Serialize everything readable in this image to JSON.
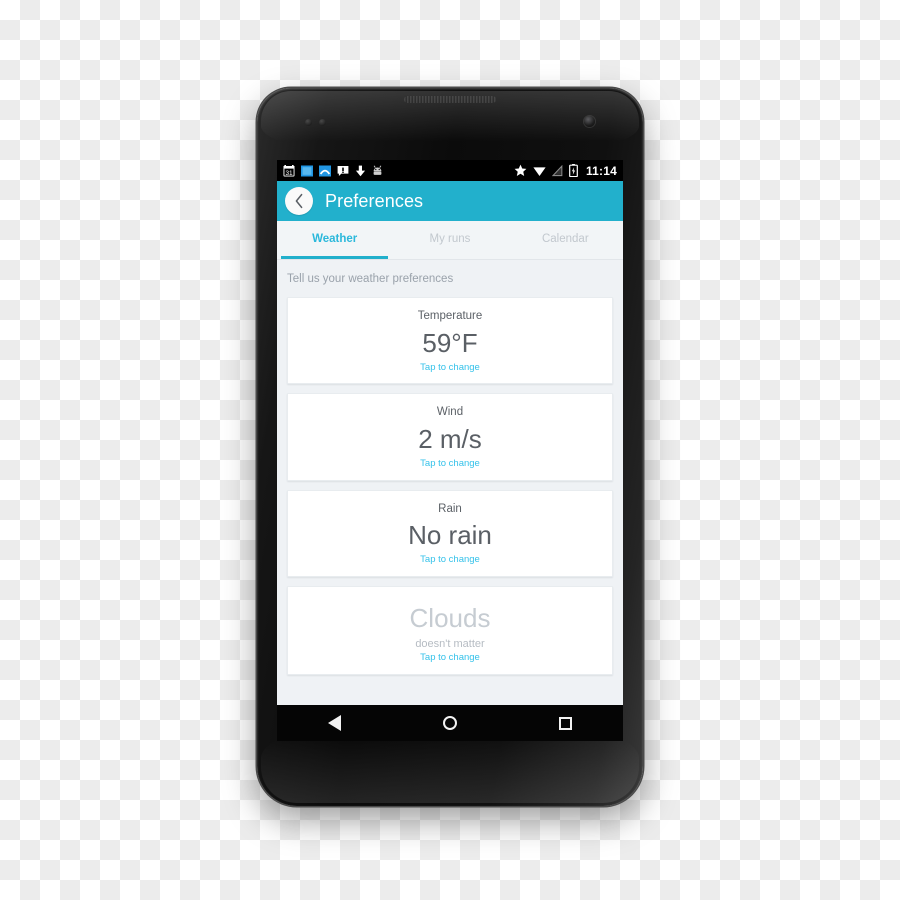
{
  "device": {
    "name": "android-phone-nexus",
    "frame_color": "#111111"
  },
  "status_bar": {
    "time": "11:14",
    "left_icons": [
      {
        "name": "calendar-icon",
        "label": "31"
      },
      {
        "name": "blue-square-icon",
        "label": ""
      },
      {
        "name": "weather-arc-icon",
        "label": ""
      },
      {
        "name": "alert-message-icon",
        "label": "!"
      },
      {
        "name": "download-icon",
        "label": ""
      },
      {
        "name": "android-robot-icon",
        "label": ""
      }
    ],
    "right_icons": [
      {
        "name": "star-icon",
        "label": ""
      },
      {
        "name": "wifi-icon",
        "label": ""
      },
      {
        "name": "signal-icon",
        "label": ""
      },
      {
        "name": "battery-charging-icon",
        "label": ""
      }
    ],
    "background": "#000000"
  },
  "action_bar": {
    "title": "Preferences",
    "back_icon": "chevron-left-icon",
    "background": "#22b0cc",
    "title_color": "#ffffff"
  },
  "tabs": {
    "active_index": 0,
    "items": [
      {
        "label": "Weather"
      },
      {
        "label": "My runs"
      },
      {
        "label": "Calendar"
      }
    ],
    "active_color": "#2bb8db",
    "inactive_color": "#c2c8ce"
  },
  "main": {
    "hint": "Tell us your weather preferences",
    "cards": [
      {
        "label": "Temperature",
        "value": "59°F",
        "sub": "",
        "action": "Tap to change",
        "muted": false
      },
      {
        "label": "Wind",
        "value": "2 m/s",
        "sub": "",
        "action": "Tap to change",
        "muted": false
      },
      {
        "label": "Rain",
        "value": "No rain",
        "sub": "",
        "action": "Tap to change",
        "muted": false
      },
      {
        "label": "",
        "value": "Clouds",
        "sub": "doesn't matter",
        "action": "Tap to change",
        "muted": true
      }
    ],
    "action_color": "#35c2ea",
    "card_background": "#ffffff",
    "page_background": "#eff2f5"
  },
  "nav_bar": {
    "buttons": [
      {
        "name": "nav-back-button",
        "icon": "triangle-left-icon"
      },
      {
        "name": "nav-home-button",
        "icon": "circle-icon"
      },
      {
        "name": "nav-recents-button",
        "icon": "square-icon"
      }
    ],
    "background": "#050505"
  }
}
